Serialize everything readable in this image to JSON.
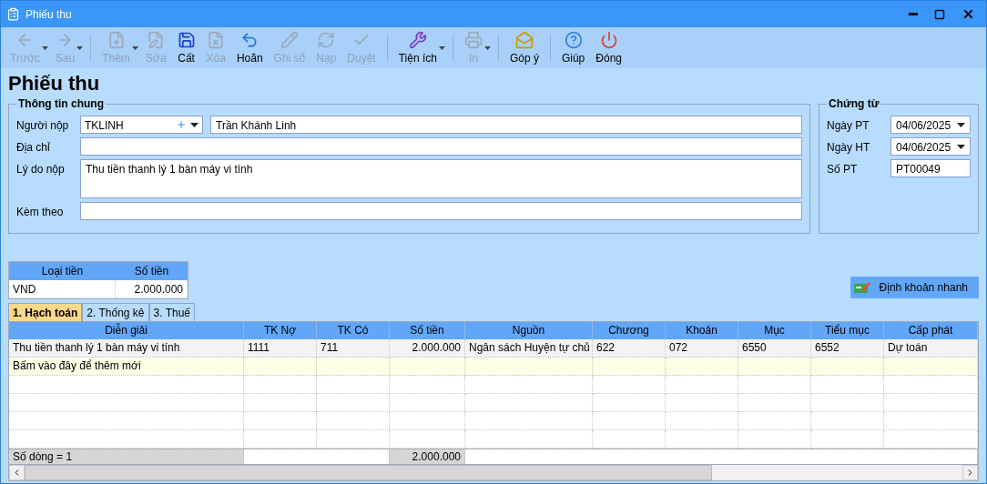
{
  "window": {
    "title": "Phiếu thu"
  },
  "toolbar": [
    {
      "kind": "button",
      "label": "Trước",
      "disabled": true,
      "dropdown": true
    },
    {
      "kind": "button",
      "label": "Sau",
      "disabled": true,
      "dropdown": true
    },
    {
      "kind": "separator"
    },
    {
      "kind": "button",
      "label": "Thêm",
      "disabled": true,
      "dropdown": true
    },
    {
      "kind": "button",
      "label": "Sửa",
      "disabled": true,
      "dropdown": false
    },
    {
      "kind": "button",
      "label": "Cất",
      "disabled": false,
      "dropdown": false
    },
    {
      "kind": "button",
      "label": "Xóa",
      "disabled": true,
      "dropdown": false
    },
    {
      "kind": "button",
      "label": "Hoãn",
      "disabled": false,
      "dropdown": false
    },
    {
      "kind": "button",
      "label": "Ghi sổ",
      "disabled": true,
      "dropdown": false
    },
    {
      "kind": "button",
      "label": "Nạp",
      "disabled": true,
      "dropdown": false
    },
    {
      "kind": "button",
      "label": "Duyệt",
      "disabled": true,
      "dropdown": false
    },
    {
      "kind": "separator"
    },
    {
      "kind": "button",
      "label": "Tiện ích",
      "disabled": false,
      "dropdown": true
    },
    {
      "kind": "separator"
    },
    {
      "kind": "button",
      "label": "In",
      "disabled": true,
      "dropdown": true
    },
    {
      "kind": "separator"
    },
    {
      "kind": "button",
      "label": "Góp ý",
      "disabled": false,
      "dropdown": false
    },
    {
      "kind": "separator"
    },
    {
      "kind": "button",
      "label": "Giúp",
      "disabled": false,
      "dropdown": false
    },
    {
      "kind": "button",
      "label": "Đóng",
      "disabled": false,
      "dropdown": false
    }
  ],
  "heading": "Phiếu thu",
  "general_info": {
    "title": "Thông tin chung",
    "fields": [
      {
        "kind": "combo",
        "label": "Người nộp",
        "code": "TKLINH",
        "value": "Trần Khánh Linh"
      },
      {
        "kind": "text",
        "label": "Địa chỉ"
      },
      {
        "kind": "textarea",
        "label": "Lý do nộp",
        "value": "Thu tiền thanh lý 1 bàn máy vi tính"
      },
      {
        "kind": "text",
        "label": "Kèm theo"
      }
    ]
  },
  "voucher": {
    "title": "Chứng từ",
    "fields": [
      {
        "kind": "date",
        "label": "Ngày PT",
        "value": "04/06/2025"
      },
      {
        "kind": "date",
        "label": "Ngày HT",
        "value": "04/06/2025"
      },
      {
        "kind": "text",
        "label": "Số PT",
        "value": "PT00049"
      }
    ]
  },
  "currency_table": {
    "columns": [
      "Loại tiền",
      "Số tiền"
    ],
    "rows": [
      [
        "VND",
        "2.000.000"
      ]
    ]
  },
  "quick_entry_button": "Định khoản nhanh",
  "tabs": [
    {
      "label": "1. Hạch toán",
      "selected": true
    },
    {
      "label": "2. Thống kê",
      "selected": false
    },
    {
      "label": "3. Thuế",
      "selected": false
    }
  ],
  "grid": {
    "columns": [
      "Diễn giải",
      "TK Nợ",
      "TK Có",
      "Số tiền",
      "Nguồn",
      "Chương",
      "Khoản",
      "Mục",
      "Tiểu mục",
      "Cấp phát"
    ],
    "rows": [
      [
        "Thu tiền thanh lý 1 bàn máy vi tính",
        "1111",
        "711",
        "2.000.000",
        "Ngân sách Huyện tự chủ",
        "622",
        "072",
        "6550",
        "6552",
        "Dự toán"
      ]
    ],
    "new_row_hint": "Bấm vào đây để thêm mới",
    "footer": {
      "label": "Số dòng = 1",
      "total": "2.000.000"
    }
  }
}
